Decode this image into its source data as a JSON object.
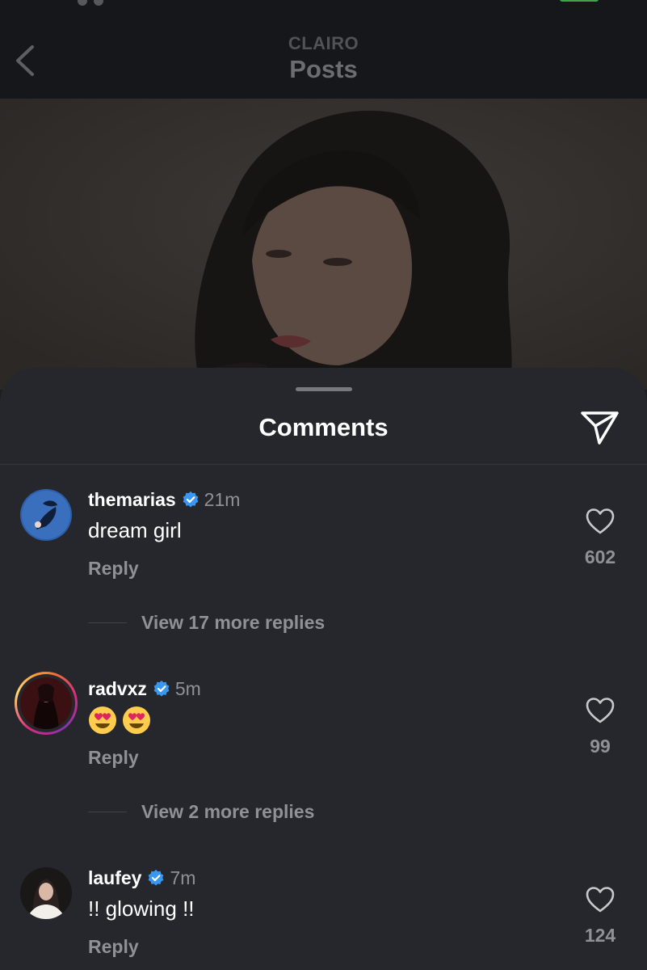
{
  "header": {
    "subtitle": "CLAIRO",
    "title": "Posts"
  },
  "sheet": {
    "title": "Comments"
  },
  "comments": [
    {
      "username": "themarias",
      "time": "21m",
      "text": "dream girl",
      "reply_label": "Reply",
      "likes": "602",
      "view_replies": "View 17 more replies"
    },
    {
      "username": "radvxz",
      "time": "5m",
      "text": "",
      "emoji": [
        "heart-eyes-emoji",
        "heart-eyes-emoji"
      ],
      "reply_label": "Reply",
      "likes": "99",
      "view_replies": "View 2 more replies"
    },
    {
      "username": "laufey",
      "time": "7m",
      "text": "!! glowing !!",
      "reply_label": "Reply",
      "likes": "124"
    }
  ],
  "colors": {
    "background": "#25272c",
    "header": "#15171a",
    "verified": "#3897f0",
    "muted_text": "#8e9196"
  },
  "icons": {
    "back": "chevron-left-icon",
    "share": "paper-plane-icon",
    "like": "heart-outline-icon",
    "verified": "verified-badge-icon"
  }
}
